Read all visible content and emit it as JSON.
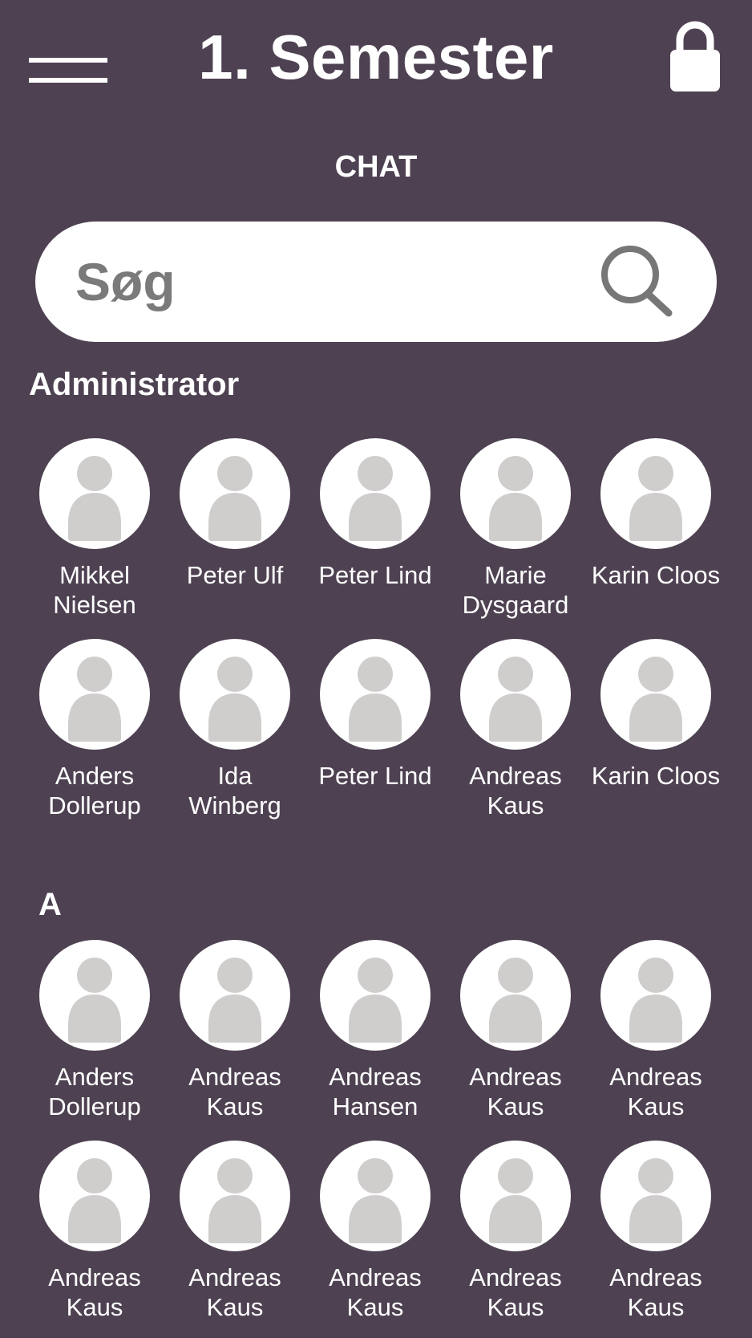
{
  "header": {
    "title": "1. Semester",
    "menu_icon": "hamburger-menu-icon",
    "lock_icon": "lock-icon"
  },
  "section_heading": "CHAT",
  "search": {
    "placeholder": "Søg",
    "value": "",
    "icon": "search-icon"
  },
  "colors": {
    "background": "#4e4252",
    "avatar_bg": "#ffffff",
    "avatar_figure": "#d0cdcd",
    "placeholder": "#7a7a7a"
  },
  "groups": [
    {
      "label": "Administrator",
      "users": [
        "Mikkel Nielsen",
        "Peter Ulf",
        "Peter Lind",
        "Marie Dysgaard",
        "Karin Cloos",
        "Anders Dollerup",
        "Ida Winberg",
        "Peter Lind",
        "Andreas Kaus",
        "Karin Cloos"
      ]
    },
    {
      "label": "A",
      "users": [
        "Anders Dollerup",
        "Andreas Kaus",
        "Andreas Hansen",
        "Andreas Kaus",
        "Andreas Kaus",
        "Andreas Kaus",
        "Andreas Kaus",
        "Andreas Kaus",
        "Andreas Kaus",
        "Andreas Kaus"
      ]
    }
  ]
}
